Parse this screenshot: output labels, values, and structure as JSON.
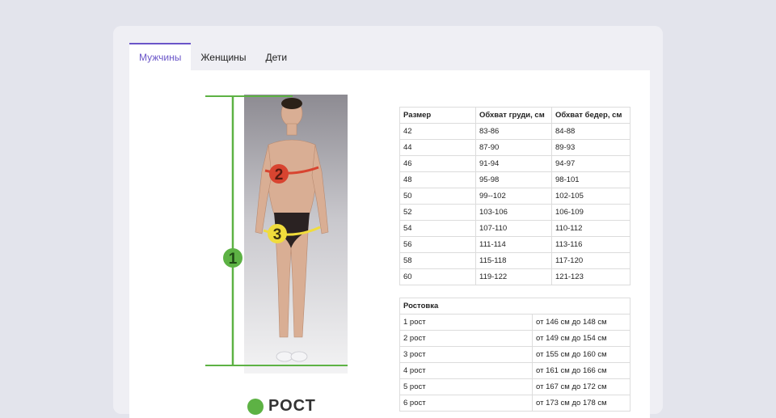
{
  "tabs": [
    {
      "label": "Мужчины",
      "active": true
    },
    {
      "label": "Женщины",
      "active": false
    },
    {
      "label": "Дети",
      "active": false
    }
  ],
  "figure": {
    "markers": {
      "height": "1",
      "chest": "2",
      "hips": "3"
    },
    "colors": {
      "height": "#5db244",
      "chest": "#d84430",
      "hips": "#f0dc3c"
    }
  },
  "size_table": {
    "headers": [
      "Размер",
      "Обхват груди, см",
      "Обхват бедер, см"
    ],
    "rows": [
      [
        "42",
        "83-86",
        "84-88"
      ],
      [
        "44",
        "87-90",
        "89-93"
      ],
      [
        "46",
        "91-94",
        "94-97"
      ],
      [
        "48",
        "95-98",
        "98-101"
      ],
      [
        "50",
        "99--102",
        "102-105"
      ],
      [
        "52",
        "103-106",
        "106-109"
      ],
      [
        "54",
        "107-110",
        "110-112"
      ],
      [
        "56",
        "111-114",
        "113-116"
      ],
      [
        "58",
        "115-118",
        "117-120"
      ],
      [
        "60",
        "119-122",
        "121-123"
      ]
    ]
  },
  "height_table": {
    "header": "Ростовка",
    "rows": [
      [
        "1 рост",
        "от 146 см до 148 см"
      ],
      [
        "2 рост",
        "от 149 см до 154 см"
      ],
      [
        "3 рост",
        "от 155 см до 160 см"
      ],
      [
        "4 рост",
        "от 161 см до 166 см"
      ],
      [
        "5 рост",
        "от 167 см до 172 см"
      ],
      [
        "6 рост",
        "от 173 см до 178 см"
      ]
    ]
  },
  "legend": {
    "label": "РОСТ"
  }
}
